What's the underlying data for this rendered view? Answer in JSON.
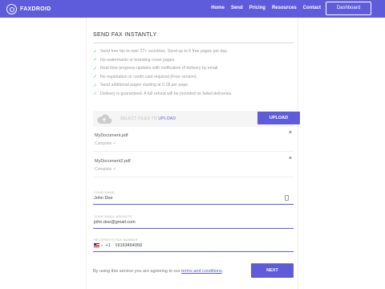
{
  "header": {
    "logo_text": "FAXDROID",
    "nav": [
      "Home",
      "Send",
      "Pricing",
      "Resources",
      "Contact"
    ],
    "dashboard_label": "Dashboard"
  },
  "form": {
    "title": "SEND FAX INSTANTLY",
    "features": [
      "Send free fax to over 27+ countries. Send up to 6 free pages per day.",
      "No watermarks or branding cover pages.",
      "Real time progress updates with notification of delivery by email.",
      "No registration or credit card required (Free version).",
      "Send additional pages starting at 0.1$ per page.",
      "Delivery is guaranteed. A full refund will be provided on failed deliveries."
    ],
    "upload": {
      "prompt": "SELECT FILES TO ",
      "prompt_link": "UPLOAD",
      "button_label": "UPLOAD"
    },
    "files": [
      {
        "name": "MyDocument.pdf",
        "status": "Complete",
        "close": "×"
      },
      {
        "name": "MyDocument2.pdf",
        "status": "Complete",
        "close": "×"
      }
    ],
    "fields": {
      "name": {
        "label": "YOUR NAME",
        "value": "John Doe"
      },
      "email": {
        "label": "YOUR EMAIL ADDRESS",
        "value": "john.doe@gmail.com"
      },
      "phone": {
        "label": "RECIPIENTS FAX NUMBER",
        "country_code": "+1",
        "value": "19193464958"
      }
    },
    "terms_prefix": "By using this service you are agreeing to our ",
    "terms_link": "terms and conditions",
    "terms_suffix": ".",
    "next_label": "NEXT"
  },
  "colors": {
    "accent": "#5E5CDB",
    "check": "#6cc070"
  }
}
